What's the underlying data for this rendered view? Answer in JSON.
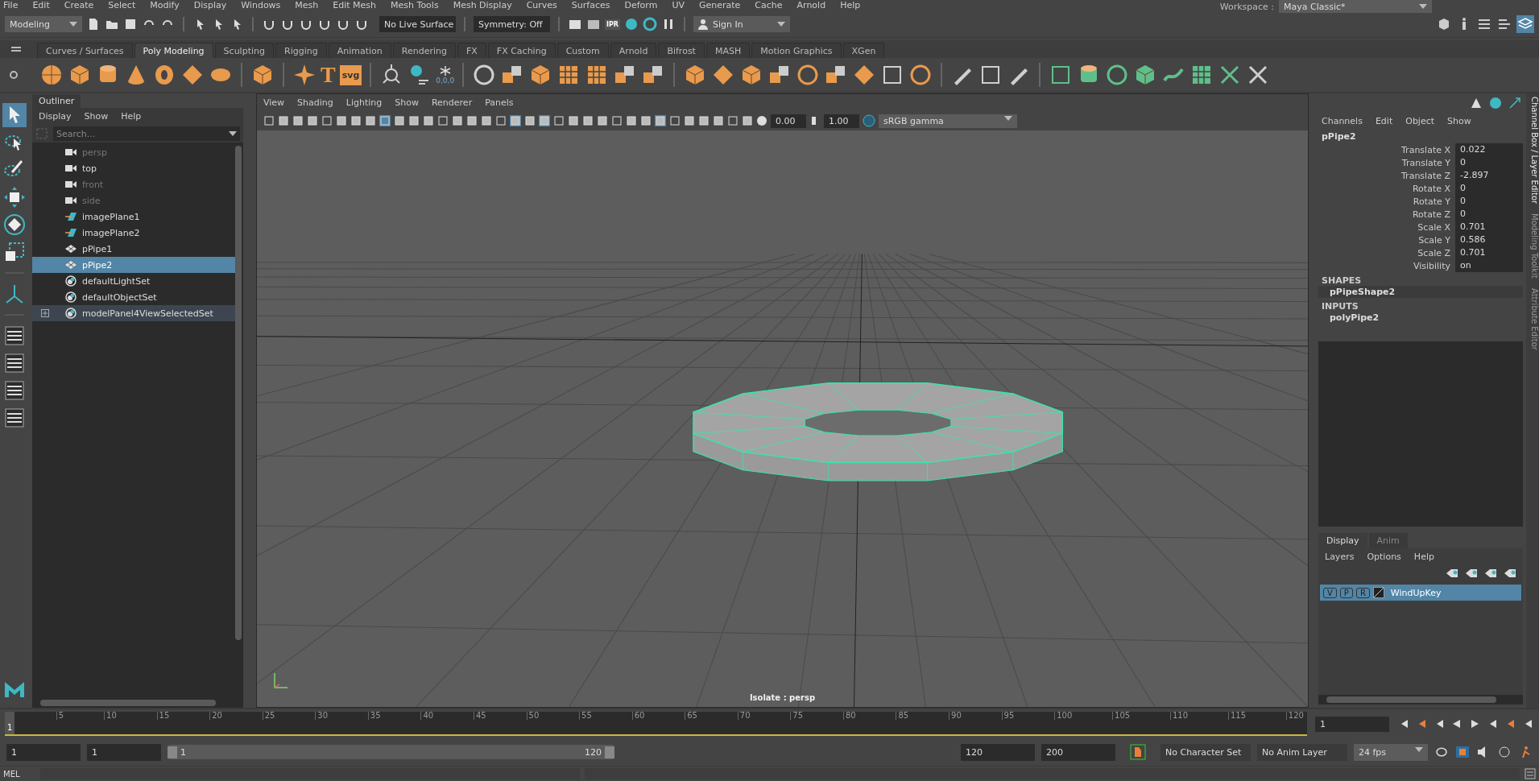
{
  "menu_bar": [
    "File",
    "Edit",
    "Create",
    "Select",
    "Modify",
    "Display",
    "Windows",
    "Mesh",
    "Edit Mesh",
    "Mesh Tools",
    "Mesh Display",
    "Curves",
    "Surfaces",
    "Deform",
    "UV",
    "Generate",
    "Cache",
    "Arnold",
    "Help"
  ],
  "status_line": {
    "mode": "Modeling",
    "live_surface": "No Live Surface",
    "symmetry": "Symmetry: Off",
    "ipr": "IPR",
    "sign_in": "Sign In",
    "workspace_label": "Workspace :",
    "workspace": "Maya Classic*"
  },
  "shelf_tabs": [
    {
      "label": "Curves / Surfaces",
      "selected": false
    },
    {
      "label": "Poly Modeling",
      "selected": true
    },
    {
      "label": "Sculpting",
      "selected": false
    },
    {
      "label": "Rigging",
      "selected": false
    },
    {
      "label": "Animation",
      "selected": false
    },
    {
      "label": "Rendering",
      "selected": false
    },
    {
      "label": "FX",
      "selected": false
    },
    {
      "label": "FX Caching",
      "selected": false
    },
    {
      "label": "Custom",
      "selected": false
    },
    {
      "label": "Arnold",
      "selected": false
    },
    {
      "label": "Bifrost",
      "selected": false
    },
    {
      "label": "MASH",
      "selected": false
    },
    {
      "label": "Motion Graphics",
      "selected": false
    },
    {
      "label": "XGen",
      "selected": false
    }
  ],
  "shelf_icon_texts": {
    "type_tool": "T",
    "svg_tool": "svg",
    "snowflake_values": "0,0,0"
  },
  "outliner": {
    "title": "Outliner",
    "menus": [
      "Display",
      "Show",
      "Help"
    ],
    "search_placeholder": "Search...",
    "items": [
      {
        "label": "persp",
        "kind": "camera",
        "dimmed": true,
        "selected": false,
        "expandable": false
      },
      {
        "label": "top",
        "kind": "camera",
        "dimmed": false,
        "selected": false,
        "expandable": false
      },
      {
        "label": "front",
        "kind": "camera",
        "dimmed": true,
        "selected": false,
        "expandable": false
      },
      {
        "label": "side",
        "kind": "camera",
        "dimmed": true,
        "selected": false,
        "expandable": false
      },
      {
        "label": "imagePlane1",
        "kind": "imageplane",
        "dimmed": false,
        "selected": false,
        "expandable": false
      },
      {
        "label": "imagePlane2",
        "kind": "imageplane",
        "dimmed": false,
        "selected": false,
        "expandable": false
      },
      {
        "label": "pPipe1",
        "kind": "mesh",
        "dimmed": false,
        "selected": false,
        "expandable": false
      },
      {
        "label": "pPipe2",
        "kind": "mesh",
        "dimmed": false,
        "selected": true,
        "expandable": false
      },
      {
        "label": "defaultLightSet",
        "kind": "set",
        "dimmed": false,
        "selected": false,
        "expandable": false
      },
      {
        "label": "defaultObjectSet",
        "kind": "set",
        "dimmed": false,
        "selected": false,
        "expandable": false
      },
      {
        "label": "modelPanel4ViewSelectedSet",
        "kind": "set",
        "dimmed": false,
        "selected": false,
        "expandable": true
      }
    ]
  },
  "viewport": {
    "menus": [
      "View",
      "Shading",
      "Lighting",
      "Show",
      "Renderer",
      "Panels"
    ],
    "exposure": "0.00",
    "gamma": "1.00",
    "color_space": "sRGB gamma",
    "hud": "Isolate : persp"
  },
  "channel_box": {
    "menus": [
      "Channels",
      "Edit",
      "Object",
      "Show"
    ],
    "object": "pPipe2",
    "channels": [
      {
        "name": "Translate X",
        "value": "0.022"
      },
      {
        "name": "Translate Y",
        "value": "0"
      },
      {
        "name": "Translate Z",
        "value": "-2.897"
      },
      {
        "name": "Rotate X",
        "value": "0"
      },
      {
        "name": "Rotate Y",
        "value": "0"
      },
      {
        "name": "Rotate Z",
        "value": "0"
      },
      {
        "name": "Scale X",
        "value": "0.701"
      },
      {
        "name": "Scale Y",
        "value": "0.586"
      },
      {
        "name": "Scale Z",
        "value": "0.701"
      },
      {
        "name": "Visibility",
        "value": "on"
      }
    ],
    "shapes_heading": "SHAPES",
    "shape": "pPipeShape2",
    "inputs_heading": "INPUTS",
    "input": "polyPipe2"
  },
  "layer_editor": {
    "tabs": [
      {
        "label": "Display",
        "selected": true
      },
      {
        "label": "Anim",
        "selected": false
      }
    ],
    "menus": [
      "Layers",
      "Options",
      "Help"
    ],
    "layers": [
      {
        "buttons": [
          "V",
          "P",
          "R"
        ],
        "name": "WindUpKey",
        "selected": true
      }
    ]
  },
  "side_tabs": [
    "Channel Box / Layer Editor",
    "Modeling Toolkit",
    "Attribute Editor"
  ],
  "time_slider": {
    "current_frame": "1",
    "level": 0,
    "ticks": [
      "5",
      "10",
      "15",
      "20",
      "25",
      "30",
      "35",
      "40",
      "45",
      "50",
      "55",
      "60",
      "65",
      "70",
      "75",
      "80",
      "85",
      "90",
      "95",
      "100",
      "105",
      "110",
      "115",
      "120"
    ],
    "frame_field": "1"
  },
  "range_slider": {
    "level": 1,
    "start": "1",
    "playback_start": "1",
    "range_start": "1",
    "range_end": "120",
    "playback_end": "120",
    "end": "200"
  },
  "anim_controls": {
    "character_set": "No Character Set",
    "anim_layer": "No Anim Layer",
    "fps": "24 fps"
  },
  "command_line": {
    "label": "MEL"
  }
}
